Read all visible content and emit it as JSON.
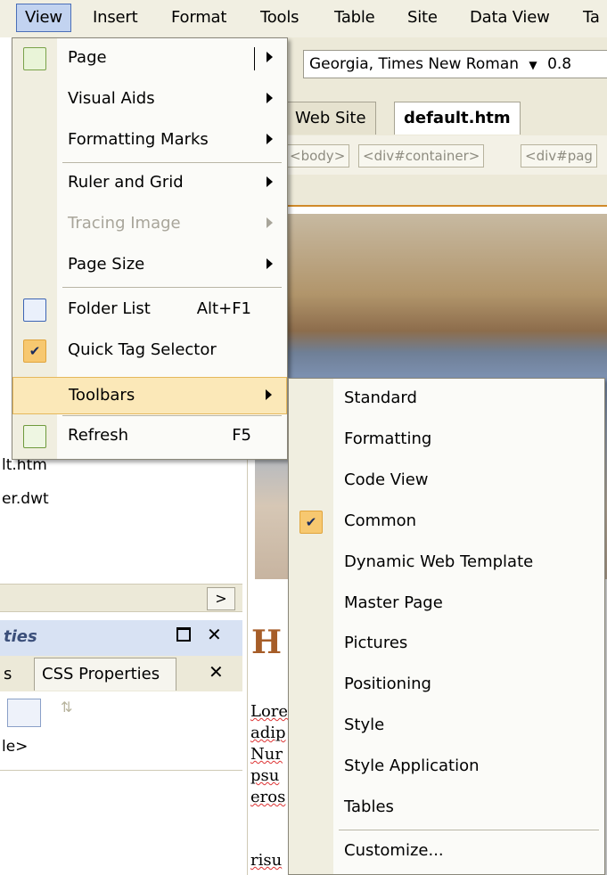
{
  "menubar": {
    "items": [
      "View",
      "Insert",
      "Format",
      "Tools",
      "Table",
      "Site",
      "Data View",
      "Ta"
    ]
  },
  "toolbar": {
    "font_value": "Georgia, Times New Roman",
    "font_size_partial": "0.8"
  },
  "doc_tabs": [
    "Web Site",
    "default.htm"
  ],
  "tag_selector": [
    "body",
    "div#container",
    "div#pag"
  ],
  "left_pane": {
    "files": [
      "lt.htm",
      "er.dwt"
    ],
    "panel_title": "ties",
    "panel_tabs": [
      "s",
      "CSS Properties"
    ],
    "tag_value": "le>"
  },
  "design": {
    "heading": "H",
    "lorem": [
      "Lore",
      "adip",
      "Nur",
      "psu",
      "eros",
      "risu"
    ]
  },
  "view_menu": {
    "items": [
      {
        "label": "Page",
        "shortcut": "",
        "submenu": true,
        "icon": "page-icon",
        "checked": false,
        "disabled": false,
        "highlighted": false
      },
      {
        "label": "Visual Aids",
        "shortcut": "",
        "submenu": true,
        "icon": "",
        "checked": false,
        "disabled": false,
        "highlighted": false
      },
      {
        "label": "Formatting Marks",
        "shortcut": "",
        "submenu": true,
        "icon": "",
        "checked": false,
        "disabled": false,
        "highlighted": false
      },
      {
        "label": "Ruler and Grid",
        "shortcut": "",
        "submenu": true,
        "icon": "",
        "checked": false,
        "disabled": false,
        "highlighted": false
      },
      {
        "label": "Tracing Image",
        "shortcut": "",
        "submenu": true,
        "icon": "",
        "checked": false,
        "disabled": true,
        "highlighted": false
      },
      {
        "label": "Page Size",
        "shortcut": "",
        "submenu": true,
        "icon": "",
        "checked": false,
        "disabled": false,
        "highlighted": false
      },
      {
        "label": "Folder List",
        "shortcut": "Alt+F1",
        "submenu": false,
        "icon": "folder-list-icon",
        "checked": false,
        "disabled": false,
        "highlighted": false
      },
      {
        "label": "Quick Tag Selector",
        "shortcut": "",
        "submenu": false,
        "icon": "check-icon",
        "checked": true,
        "disabled": false,
        "highlighted": false
      },
      {
        "label": "Toolbars",
        "shortcut": "",
        "submenu": true,
        "icon": "",
        "checked": false,
        "disabled": false,
        "highlighted": true
      },
      {
        "label": "Refresh",
        "shortcut": "F5",
        "submenu": false,
        "icon": "refresh-icon",
        "checked": false,
        "disabled": false,
        "highlighted": false
      }
    ]
  },
  "toolbars_submenu": {
    "items": [
      {
        "label": "Standard",
        "checked": false
      },
      {
        "label": "Formatting",
        "checked": false
      },
      {
        "label": "Code View",
        "checked": false
      },
      {
        "label": "Common",
        "checked": true
      },
      {
        "label": "Dynamic Web Template",
        "checked": false
      },
      {
        "label": "Master Page",
        "checked": false
      },
      {
        "label": "Pictures",
        "checked": false
      },
      {
        "label": "Positioning",
        "checked": false
      },
      {
        "label": "Style",
        "checked": false
      },
      {
        "label": "Style Application",
        "checked": false
      },
      {
        "label": "Tables",
        "checked": false
      },
      {
        "label": "Customize...",
        "checked": false
      }
    ]
  },
  "colors": {
    "menu_highlight": "#fbe8b8",
    "check_background": "#f7c870",
    "accent_orange": "#d18a29"
  }
}
